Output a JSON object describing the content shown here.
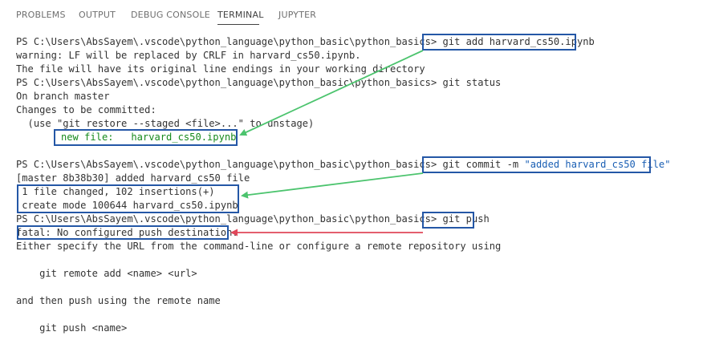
{
  "tabs": [
    {
      "label": "PROBLEMS"
    },
    {
      "label": "OUTPUT"
    },
    {
      "label": "DEBUG CONSOLE"
    },
    {
      "label": "TERMINAL",
      "active": true
    },
    {
      "label": "JUPYTER"
    }
  ],
  "terminal": {
    "prompt": "PS C:\\Users\\AbsSayem\\.vscode\\python_language\\python_basic\\python_basics>",
    "cmd1": "git add harvard_cs50.ipynb",
    "warn1": "warning: LF will be replaced by CRLF in harvard_cs50.ipynb.",
    "warn2": "The file will have its original line endings in your working directory",
    "cmd2": "git status",
    "branch": "On branch master",
    "changes": "Changes to be committed:",
    "restore_hint": "  (use \"git restore --staged <file>...\" to unstage)",
    "new_file_label": "new file:",
    "new_file_name": "harvard_cs50.ipynb",
    "cmd3_prefix": "git commit -m ",
    "cmd3_msg": "\"added harvard_cs50 file\"",
    "commit_result": "[master 8b38b30] added harvard_cs50 file",
    "stat1": " 1 file changed, 102 insertions(+)",
    "stat2": " create mode 100644 harvard_cs50.ipynb",
    "cmd4": "git push",
    "fatal": "fatal: No configured push destination.",
    "either": "Either specify the URL from the command-line or configure a remote repository using",
    "remote_add": "    git remote add <name> <url>",
    "then_push": "and then push using the remote name",
    "push_name": "    git push <name>"
  },
  "colors": {
    "annotation_box": "#2457a6",
    "arrow_green": "#4cc46e",
    "arrow_red": "#e0475a",
    "staged_text": "#178a1c"
  }
}
